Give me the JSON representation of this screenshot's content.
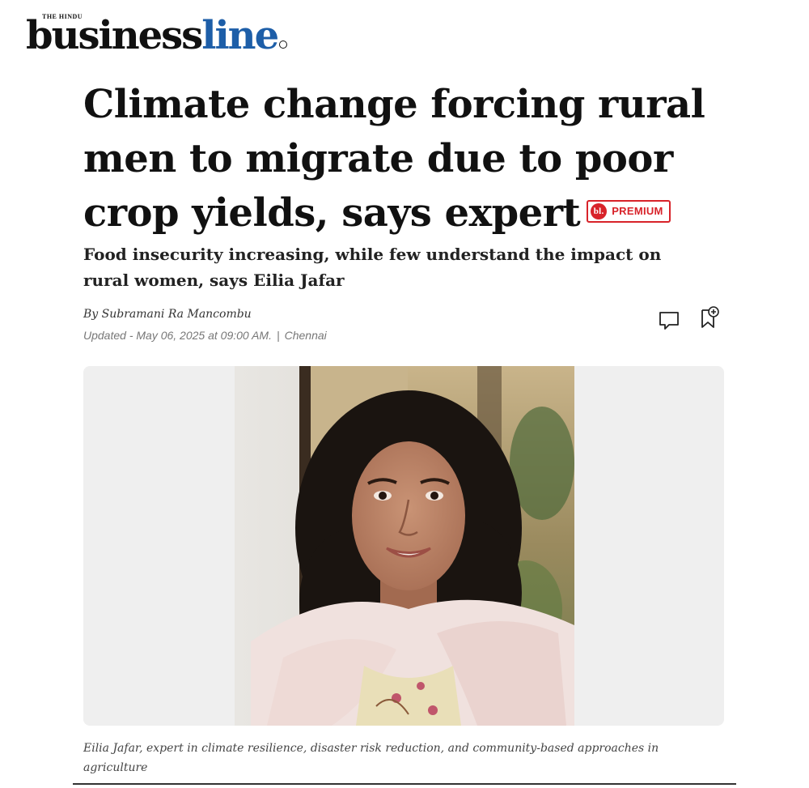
{
  "masthead": {
    "small_text": "THE HINDU",
    "brand_part1": "business",
    "brand_part2": "line",
    "brand_color": "#1d5ea8"
  },
  "article": {
    "headline": "Climate change forcing rural men to migrate due to poor crop yields, says expert",
    "premium_badge": {
      "logo": "bl.",
      "label": "PREMIUM",
      "color": "#d8232a"
    },
    "subheadline": "Food insecurity increasing, while few understand the impact on rural women, says Eilia Jafar",
    "byline": "By Subramani Ra Mancombu",
    "updated": "Updated - May 06, 2025 at 09:00 AM.",
    "separator": "|",
    "location": "Chennai",
    "actions": {
      "comment_icon": "comment-icon",
      "bookmark_icon": "bookmark-add-icon"
    },
    "image_caption": "Eilia Jafar, expert in climate resilience, disaster risk reduction, and community-based approaches in agriculture"
  }
}
